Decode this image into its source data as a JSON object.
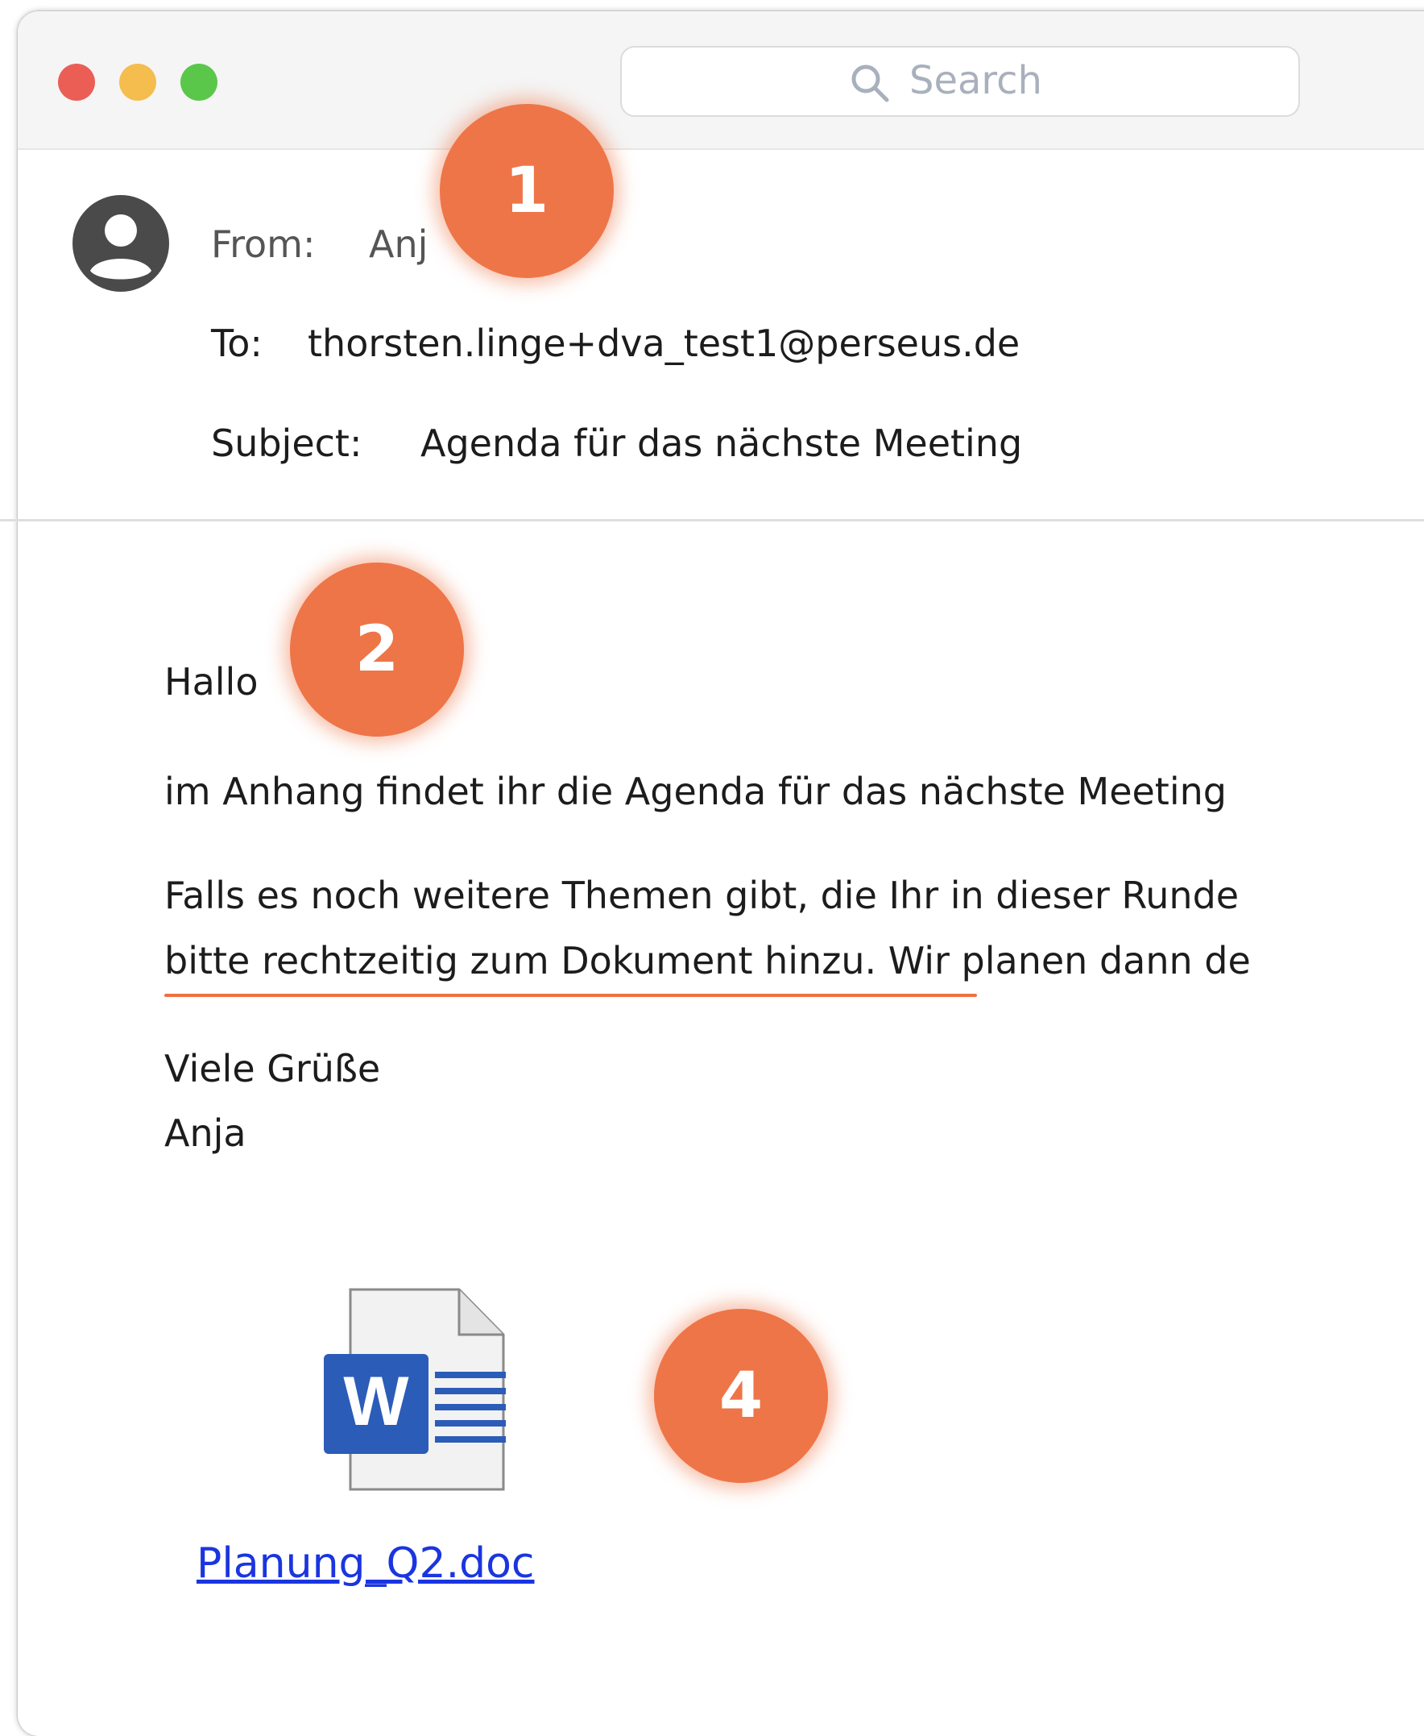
{
  "window": {
    "controls": [
      "close",
      "minimize",
      "zoom"
    ]
  },
  "search": {
    "placeholder": "Search",
    "icon": "search-icon"
  },
  "header": {
    "from_label": "From:",
    "from_value": "Anj",
    "to_label": "To:",
    "to_value": "thorsten.linge+dva_test1@perseus.de",
    "subject_label": "Subject:",
    "subject_value": "Agenda für das nächste Meeting",
    "avatar_icon": "user-avatar-icon"
  },
  "body": {
    "greeting": "Hallo",
    "line1": "im Anhang findet ihr die Agenda für das nächste Meeting",
    "line2": "Falls es noch weitere Themen gibt, die Ihr in dieser Runde",
    "line3": "bitte rechtzeitig zum Dokument hinzu. Wir planen dann de",
    "closing": "Viele Grüße",
    "signature": "Anja"
  },
  "attachment": {
    "filename": "Planung_Q2.doc",
    "icon": "word-document-icon",
    "icon_letter": "W"
  },
  "markers": [
    "1",
    "2",
    "4"
  ],
  "colors": {
    "marker": "#ee7547",
    "link": "#1a35e0",
    "underline": "#ee7142",
    "traffic_red": "#eb5e56",
    "traffic_yellow": "#f4bd4e",
    "traffic_green": "#5ac74a",
    "word_blue": "#2b5cb8"
  }
}
